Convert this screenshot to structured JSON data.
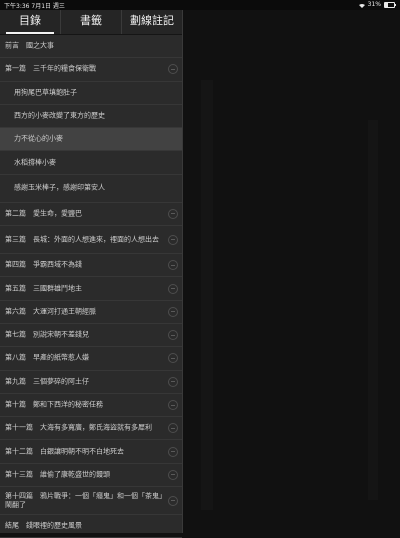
{
  "status_bar": {
    "time": "下午3:36  7月1日 週三",
    "battery": "31%"
  },
  "tabs": [
    {
      "label": "目錄",
      "active": true
    },
    {
      "label": "書籤",
      "active": false
    },
    {
      "label": "劃線註記",
      "active": false
    }
  ],
  "toc": [
    {
      "label": "前言　國之大事",
      "level": 0,
      "chevron": false
    },
    {
      "label": "第一篇　三千年的糧食保衛戰",
      "level": 0,
      "chevron": true
    },
    {
      "label": "用狗尾巴草填飽肚子",
      "level": 1,
      "chevron": false
    },
    {
      "label": "西方的小麥改變了東方的歷史",
      "level": 1,
      "chevron": false
    },
    {
      "label": "力不從心的小麥",
      "level": 1,
      "chevron": false,
      "selected": true
    },
    {
      "label": "水稻撐棒小麥",
      "level": 1,
      "chevron": false
    },
    {
      "label": "感謝玉米棒子，感謝印第安人",
      "level": 1,
      "chevron": false
    },
    {
      "label": "第二篇　愛生命，愛鹽巴",
      "level": 0,
      "chevron": true
    },
    {
      "label": "第三篇　長城：外面的人想進來，裡面的人想出去",
      "level": 0,
      "chevron": true,
      "tall": true
    },
    {
      "label": "第四篇　爭霸西域不為錢",
      "level": 0,
      "chevron": true
    },
    {
      "label": "第五篇　三國群雄鬥地主",
      "level": 0,
      "chevron": true
    },
    {
      "label": "第六篇　大運河打通王朝經脈",
      "level": 0,
      "chevron": true
    },
    {
      "label": "第七篇　別說宋朝不差錢兒",
      "level": 0,
      "chevron": true
    },
    {
      "label": "第八篇　早產的紙幣惹人嫌",
      "level": 0,
      "chevron": true
    },
    {
      "label": "第九篇　三個夢碎的阿土仔",
      "level": 0,
      "chevron": true
    },
    {
      "label": "第十篇　鄭和下西洋的秘密任務",
      "level": 0,
      "chevron": true
    },
    {
      "label": "第十一篇　大海有多寬廣，鄭氏海盜就有多犀利",
      "level": 0,
      "chevron": true
    },
    {
      "label": "第十二篇　白銀讓明朝不明不白地死去",
      "level": 0,
      "chevron": true
    },
    {
      "label": "第十三篇　誰偷了康乾盛世的饅頭",
      "level": 0,
      "chevron": true
    },
    {
      "label": "第十四篇　鴉片戰爭：一個「癮鬼」和一個「茶鬼」鬧翻了",
      "level": 0,
      "chevron": true,
      "tall": true
    },
    {
      "label": "結尾　錢眼裡的歷史風景",
      "level": 0,
      "chevron": false
    }
  ]
}
